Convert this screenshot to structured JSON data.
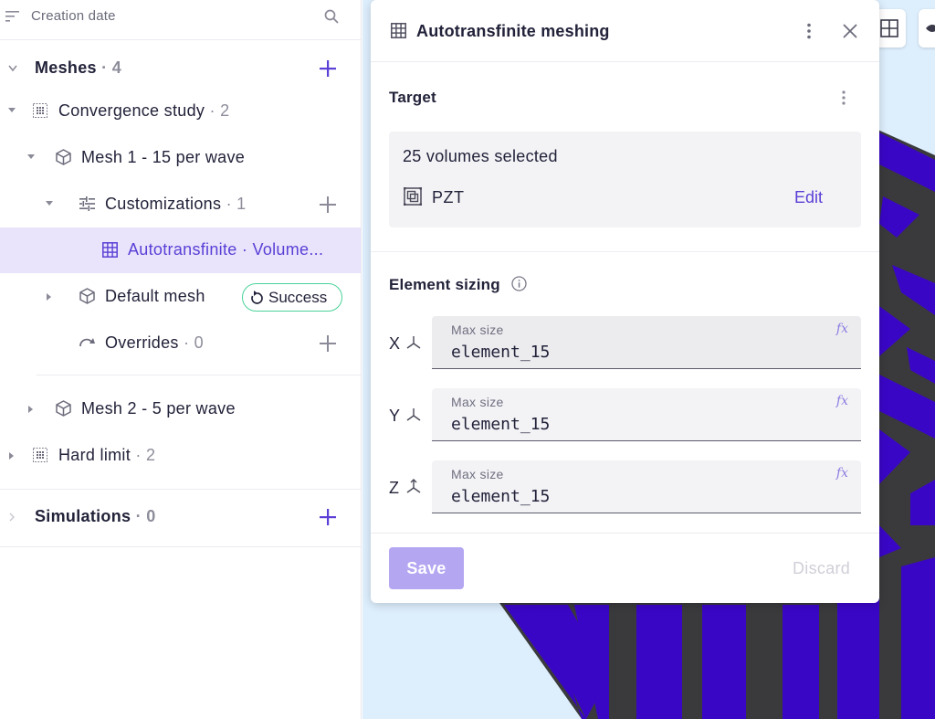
{
  "sidebar": {
    "sort_label": "Creation date",
    "meshes": {
      "label": "Meshes",
      "count": "4"
    },
    "convergence": {
      "label": "Convergence study",
      "count": "2"
    },
    "mesh1": {
      "label": "Mesh 1 - 15 per wave"
    },
    "customizations": {
      "label": "Customizations",
      "count": "1"
    },
    "autotransfinite": {
      "label": "Autotransfinite",
      "suffix": "Volume..."
    },
    "default_mesh": {
      "label": "Default mesh",
      "status": "Success"
    },
    "overrides": {
      "label": "Overrides",
      "count": "0"
    },
    "mesh2": {
      "label": "Mesh 2 - 5 per wave"
    },
    "hard_limit": {
      "label": "Hard limit",
      "count": "2"
    },
    "simulations": {
      "label": "Simulations",
      "count": "0"
    },
    "separator": "·"
  },
  "dialog": {
    "title": "Autotransfinite meshing",
    "target": {
      "title": "Target",
      "count_text": "25 volumes selected",
      "item": "PZT",
      "edit_label": "Edit"
    },
    "sizing": {
      "title": "Element sizing",
      "fields": [
        {
          "axis": "X",
          "label": "Max size",
          "value": "element_15",
          "fx": "fx"
        },
        {
          "axis": "Y",
          "label": "Max size",
          "value": "element_15",
          "fx": "fx"
        },
        {
          "axis": "Z",
          "label": "Max size",
          "value": "element_15",
          "fx": "fx"
        }
      ]
    },
    "save_label": "Save",
    "discard_label": "Discard"
  },
  "colors": {
    "accent": "#5b3fd6",
    "selected_bg": "#e9e4fb",
    "success_border": "#4ad39a",
    "viewport_bg": "#ddeefc",
    "mesh_purple": "#3a06c6",
    "mesh_gray": "#3a3a3c"
  },
  "icons": {
    "sort": "sort-icon",
    "search": "search-icon",
    "plus": "plus-icon",
    "grid": "grid-icon",
    "cube": "cube-icon",
    "tune": "tune-icon",
    "refresh": "refresh-icon",
    "info": "info-icon",
    "close": "close-icon",
    "kebab": "kebab-icon",
    "axis": "axis-icon",
    "volume": "volume-icon"
  }
}
